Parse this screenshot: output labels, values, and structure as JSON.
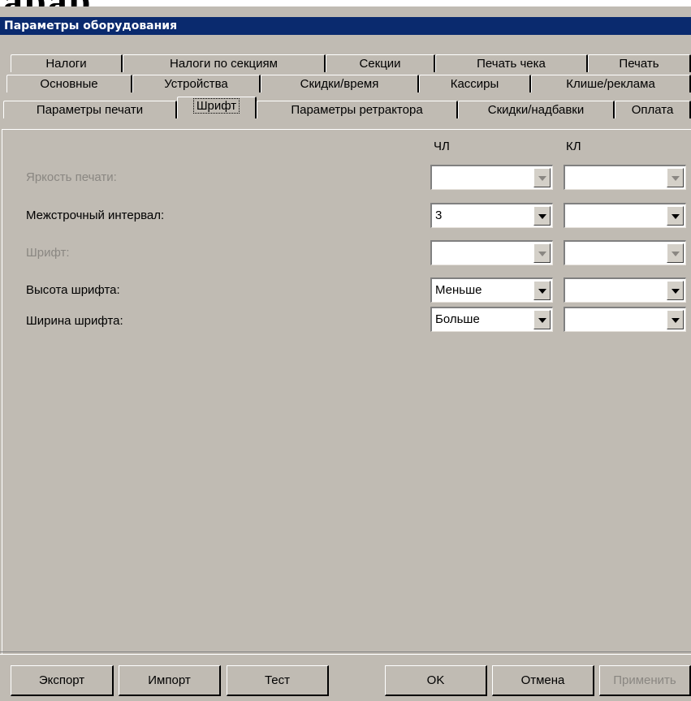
{
  "fragment_text": "арар",
  "window": {
    "title": "Параметры оборудования"
  },
  "tabs": {
    "row1": [
      "Налоги",
      "Налоги по секциям",
      "Секции",
      "Печать чека",
      "Печать"
    ],
    "row2": [
      "Основные",
      "Устройства",
      "Скидки/время",
      "Кассиры",
      "Клише/реклама"
    ],
    "row3": [
      "Параметры печати",
      "Шрифт",
      "Параметры ретрактора",
      "Скидки/надбавки",
      "Оплата"
    ],
    "active": "Шрифт"
  },
  "columns": {
    "chl": "ЧЛ",
    "kl": "КЛ"
  },
  "rows": [
    {
      "label": "Яркость печати:",
      "chl": "",
      "kl": "",
      "enabled": false
    },
    {
      "label": "Межстрочный интервал:",
      "chl": "3",
      "kl": "",
      "enabled": true
    },
    {
      "label": "Шрифт:",
      "chl": "",
      "kl": "",
      "enabled": false
    },
    {
      "label": "Высота шрифта:",
      "chl": "Меньше",
      "kl": "",
      "enabled": true
    },
    {
      "label": "Ширина шрифта:",
      "chl": "Больше",
      "kl": "",
      "enabled": true
    }
  ],
  "buttons": {
    "export": "Экспорт",
    "import": "Импорт",
    "test": "Тест",
    "ok": "OK",
    "cancel": "Отмена",
    "apply": "Применить"
  },
  "icons": {
    "dropdown": "chevron-down-icon"
  }
}
